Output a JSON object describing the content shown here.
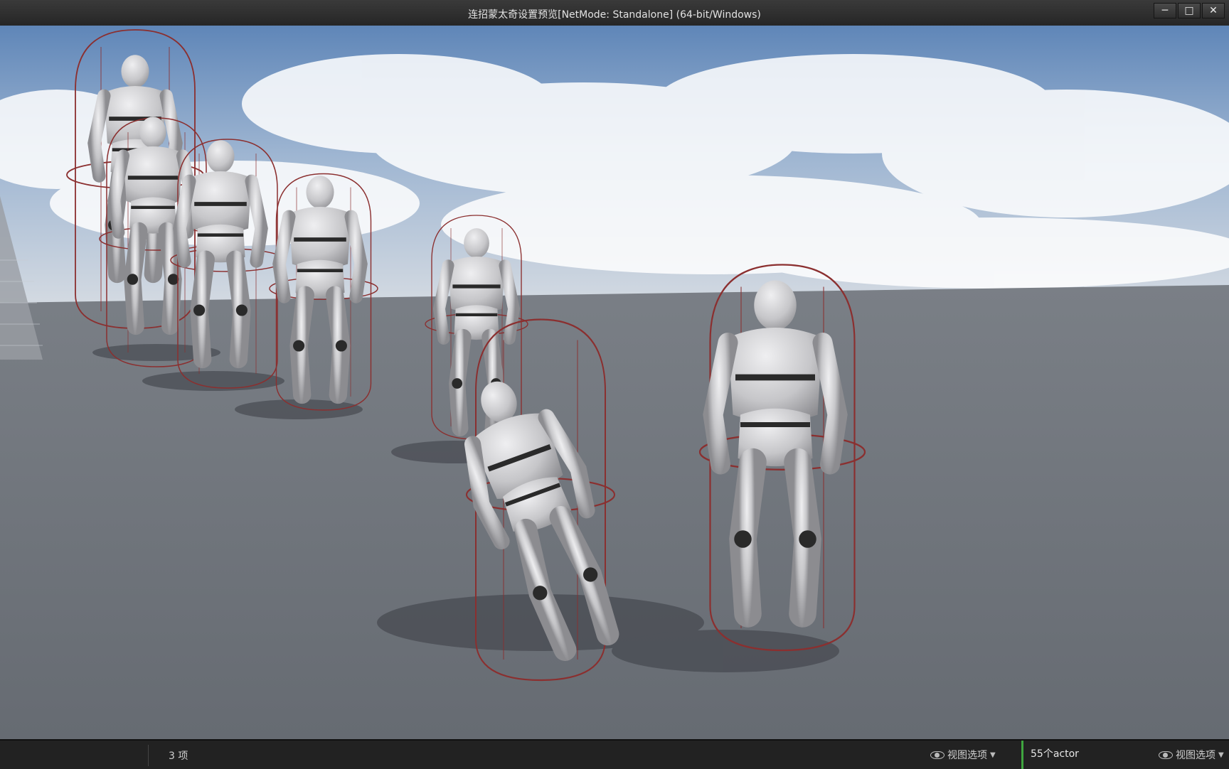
{
  "window": {
    "title": "连招蒙太奇设置预览[NetMode: Standalone]  (64-bit/Windows)",
    "minimize_icon": "minimize-icon",
    "maximize_icon": "maximize-icon",
    "close_icon": "close-icon"
  },
  "viewport": {
    "scene": "3D game viewport: grey floor, sky with clouds, grey mannequin characters with red capsule collision outlines",
    "colors": {
      "sky_top": "#5f86b8",
      "sky_bottom": "#d8dde3",
      "floor": "#6f747c",
      "capsule": "#8b2f2f",
      "mannequin": "#c9c9cc"
    }
  },
  "status_left": {
    "count": "3 项",
    "view_options": "视图选项"
  },
  "status_right": {
    "actor_count": "55个actor",
    "view_options": "视图选项",
    "accent": "#3fa63f"
  }
}
